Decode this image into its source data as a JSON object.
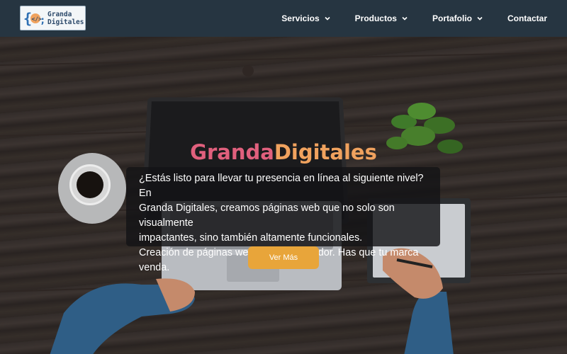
{
  "brand": {
    "logo_line1": "Granda",
    "logo_line2": "Digitales",
    "colors": {
      "title_pink": "#e0607d",
      "title_orange": "#f0a25e",
      "button": "#e8a53a",
      "nav_bg": "#263541"
    }
  },
  "nav": {
    "items": [
      {
        "label": "Servicios",
        "has_dropdown": true,
        "icon": "chevron-down-icon"
      },
      {
        "label": "Productos",
        "has_dropdown": true,
        "icon": "chevron-down-icon"
      },
      {
        "label": "Portafolio",
        "has_dropdown": true,
        "icon": "chevron-down-icon"
      },
      {
        "label": "Contactar",
        "has_dropdown": false
      }
    ]
  },
  "hero": {
    "title_part1": "Granda",
    "title_part2": "Digitales",
    "description_line1": "¿Estás listo para llevar tu presencia en línea al siguiente nivel? En",
    "description_line2": "Granda Digitales, creamos páginas web que no solo son visualmente",
    "description_line3": "impactantes, sino también altamente funcionales.",
    "description_line4": "Creación de páginas web Cuenca Ecuador. Has que tu marca venda.",
    "cta_label": "Ver Más"
  }
}
